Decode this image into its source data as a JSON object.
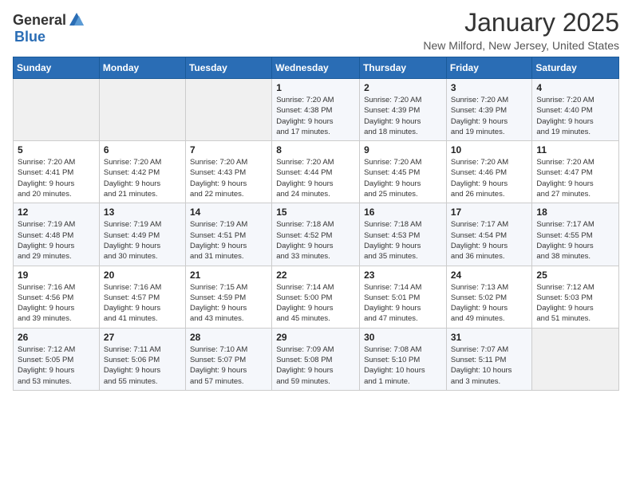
{
  "header": {
    "logo_general": "General",
    "logo_blue": "Blue",
    "month": "January 2025",
    "location": "New Milford, New Jersey, United States"
  },
  "weekdays": [
    "Sunday",
    "Monday",
    "Tuesday",
    "Wednesday",
    "Thursday",
    "Friday",
    "Saturday"
  ],
  "weeks": [
    [
      {
        "day": "",
        "info": ""
      },
      {
        "day": "",
        "info": ""
      },
      {
        "day": "",
        "info": ""
      },
      {
        "day": "1",
        "info": "Sunrise: 7:20 AM\nSunset: 4:38 PM\nDaylight: 9 hours\nand 17 minutes."
      },
      {
        "day": "2",
        "info": "Sunrise: 7:20 AM\nSunset: 4:39 PM\nDaylight: 9 hours\nand 18 minutes."
      },
      {
        "day": "3",
        "info": "Sunrise: 7:20 AM\nSunset: 4:39 PM\nDaylight: 9 hours\nand 19 minutes."
      },
      {
        "day": "4",
        "info": "Sunrise: 7:20 AM\nSunset: 4:40 PM\nDaylight: 9 hours\nand 19 minutes."
      }
    ],
    [
      {
        "day": "5",
        "info": "Sunrise: 7:20 AM\nSunset: 4:41 PM\nDaylight: 9 hours\nand 20 minutes."
      },
      {
        "day": "6",
        "info": "Sunrise: 7:20 AM\nSunset: 4:42 PM\nDaylight: 9 hours\nand 21 minutes."
      },
      {
        "day": "7",
        "info": "Sunrise: 7:20 AM\nSunset: 4:43 PM\nDaylight: 9 hours\nand 22 minutes."
      },
      {
        "day": "8",
        "info": "Sunrise: 7:20 AM\nSunset: 4:44 PM\nDaylight: 9 hours\nand 24 minutes."
      },
      {
        "day": "9",
        "info": "Sunrise: 7:20 AM\nSunset: 4:45 PM\nDaylight: 9 hours\nand 25 minutes."
      },
      {
        "day": "10",
        "info": "Sunrise: 7:20 AM\nSunset: 4:46 PM\nDaylight: 9 hours\nand 26 minutes."
      },
      {
        "day": "11",
        "info": "Sunrise: 7:20 AM\nSunset: 4:47 PM\nDaylight: 9 hours\nand 27 minutes."
      }
    ],
    [
      {
        "day": "12",
        "info": "Sunrise: 7:19 AM\nSunset: 4:48 PM\nDaylight: 9 hours\nand 29 minutes."
      },
      {
        "day": "13",
        "info": "Sunrise: 7:19 AM\nSunset: 4:49 PM\nDaylight: 9 hours\nand 30 minutes."
      },
      {
        "day": "14",
        "info": "Sunrise: 7:19 AM\nSunset: 4:51 PM\nDaylight: 9 hours\nand 31 minutes."
      },
      {
        "day": "15",
        "info": "Sunrise: 7:18 AM\nSunset: 4:52 PM\nDaylight: 9 hours\nand 33 minutes."
      },
      {
        "day": "16",
        "info": "Sunrise: 7:18 AM\nSunset: 4:53 PM\nDaylight: 9 hours\nand 35 minutes."
      },
      {
        "day": "17",
        "info": "Sunrise: 7:17 AM\nSunset: 4:54 PM\nDaylight: 9 hours\nand 36 minutes."
      },
      {
        "day": "18",
        "info": "Sunrise: 7:17 AM\nSunset: 4:55 PM\nDaylight: 9 hours\nand 38 minutes."
      }
    ],
    [
      {
        "day": "19",
        "info": "Sunrise: 7:16 AM\nSunset: 4:56 PM\nDaylight: 9 hours\nand 39 minutes."
      },
      {
        "day": "20",
        "info": "Sunrise: 7:16 AM\nSunset: 4:57 PM\nDaylight: 9 hours\nand 41 minutes."
      },
      {
        "day": "21",
        "info": "Sunrise: 7:15 AM\nSunset: 4:59 PM\nDaylight: 9 hours\nand 43 minutes."
      },
      {
        "day": "22",
        "info": "Sunrise: 7:14 AM\nSunset: 5:00 PM\nDaylight: 9 hours\nand 45 minutes."
      },
      {
        "day": "23",
        "info": "Sunrise: 7:14 AM\nSunset: 5:01 PM\nDaylight: 9 hours\nand 47 minutes."
      },
      {
        "day": "24",
        "info": "Sunrise: 7:13 AM\nSunset: 5:02 PM\nDaylight: 9 hours\nand 49 minutes."
      },
      {
        "day": "25",
        "info": "Sunrise: 7:12 AM\nSunset: 5:03 PM\nDaylight: 9 hours\nand 51 minutes."
      }
    ],
    [
      {
        "day": "26",
        "info": "Sunrise: 7:12 AM\nSunset: 5:05 PM\nDaylight: 9 hours\nand 53 minutes."
      },
      {
        "day": "27",
        "info": "Sunrise: 7:11 AM\nSunset: 5:06 PM\nDaylight: 9 hours\nand 55 minutes."
      },
      {
        "day": "28",
        "info": "Sunrise: 7:10 AM\nSunset: 5:07 PM\nDaylight: 9 hours\nand 57 minutes."
      },
      {
        "day": "29",
        "info": "Sunrise: 7:09 AM\nSunset: 5:08 PM\nDaylight: 9 hours\nand 59 minutes."
      },
      {
        "day": "30",
        "info": "Sunrise: 7:08 AM\nSunset: 5:10 PM\nDaylight: 10 hours\nand 1 minute."
      },
      {
        "day": "31",
        "info": "Sunrise: 7:07 AM\nSunset: 5:11 PM\nDaylight: 10 hours\nand 3 minutes."
      },
      {
        "day": "",
        "info": ""
      }
    ]
  ]
}
